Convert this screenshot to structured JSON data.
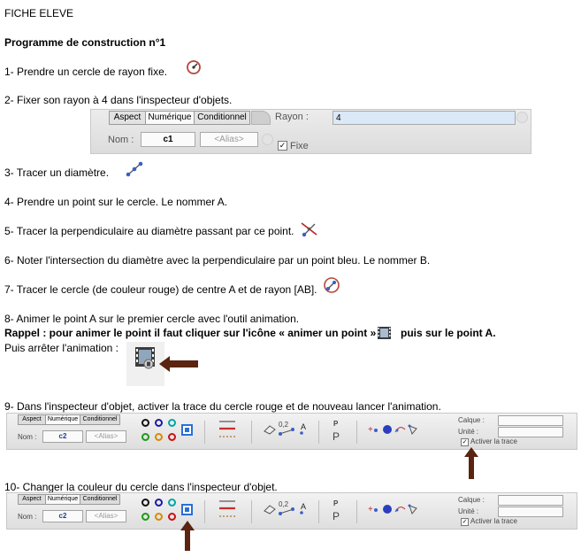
{
  "title": "FICHE ELEVE",
  "heading": "Programme de construction n°1",
  "steps": {
    "s1": "1- Prendre un cercle de rayon fixe.",
    "s2": "2- Fixer son rayon à 4 dans l'inspecteur d'objets.",
    "s3": "3- Tracer un diamètre.",
    "s4": "4- Prendre un point sur le cercle. Le nommer A.",
    "s5": "5- Tracer la perpendiculaire au diamètre passant par ce point.",
    "s6": "6- Noter l'intersection du diamètre avec la perpendiculaire par un point bleu. Le nommer B.",
    "s7": "7- Tracer le cercle (de couleur rouge) de centre A et de rayon [AB].",
    "s8": "8- Animer le point A sur le premier cercle avec l'outil animation.",
    "s8_rappel_a": "Rappel : pour animer le point il faut cliquer sur l'icône « animer un point »",
    "s8_rappel_b": "puis sur le point A.",
    "s8_stop": "Puis arrêter l'animation :",
    "s9": "9- Dans l'inspecteur d'objet, activer la trace du cercle rouge et de nouveau lancer l'animation.",
    "s10": "10- Changer la couleur du cercle dans l'inspecteur d'objet."
  },
  "inspector1": {
    "tabs": [
      "Aspect",
      "Numérique",
      "Conditionnel"
    ],
    "rayon_label": "Rayon :",
    "rayon_value": "4",
    "nom_label": "Nom :",
    "nom_value": "c1",
    "alias_placeholder": "<Alias>",
    "fixe_label": "Fixe"
  },
  "toolbar": {
    "tabs": [
      "Aspect",
      "Numérique",
      "Conditionnel"
    ],
    "nom_label": "Nom :",
    "nom_value": "c2",
    "alias_placeholder": "<Alias>",
    "decimal_label": "0,2",
    "p_small": "P",
    "p_large": "P",
    "calque_label": "Calque :",
    "unite_label": "Unité :",
    "trace_label": "Activer la trace"
  },
  "colors": {
    "arrow": "#5a2410",
    "swatches": [
      "#111111",
      "#1a1aa8",
      "#00a6a6",
      "#1a9a1a",
      "#d88a00",
      "#cc1010"
    ],
    "selected_swatch": "#2a6fd6"
  },
  "icons": [
    "circle-fixed-radius-icon",
    "segment-icon",
    "perpendicular-icon",
    "compass-circle-icon",
    "film-animation-icon"
  ]
}
